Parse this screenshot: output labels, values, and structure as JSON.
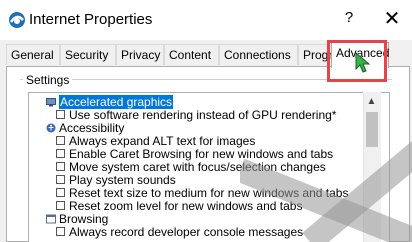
{
  "window": {
    "title": "Internet Properties",
    "help_label": "?",
    "close_label": "✕"
  },
  "tabs": [
    {
      "label": "General",
      "active": false
    },
    {
      "label": "Security",
      "active": false
    },
    {
      "label": "Privacy",
      "active": false
    },
    {
      "label": "Content",
      "active": false
    },
    {
      "label": "Connections",
      "active": false
    },
    {
      "label": "Programs",
      "active": false
    },
    {
      "label": "Advanced",
      "active": true
    }
  ],
  "settings": {
    "group_label": "Settings",
    "items": [
      {
        "type": "group",
        "icon": "monitor-icon",
        "label": "Accelerated graphics",
        "selected": true
      },
      {
        "type": "checkbox",
        "label": "Use software rendering instead of GPU rendering*",
        "checked": false
      },
      {
        "type": "group",
        "icon": "accessibility-icon",
        "label": "Accessibility"
      },
      {
        "type": "checkbox",
        "label": "Always expand ALT text for images",
        "checked": false
      },
      {
        "type": "checkbox",
        "label": "Enable Caret Browsing for new windows and tabs",
        "checked": false
      },
      {
        "type": "checkbox",
        "label": "Move system caret with focus/selection changes",
        "checked": false
      },
      {
        "type": "checkbox",
        "label": "Play system sounds",
        "checked": false
      },
      {
        "type": "checkbox",
        "label": "Reset text size to medium for new windows and tabs",
        "checked": false
      },
      {
        "type": "checkbox",
        "label": "Reset zoom level for new windows and tabs",
        "checked": false
      },
      {
        "type": "group",
        "icon": "browsing-icon",
        "label": "Browsing"
      },
      {
        "type": "checkbox",
        "label": "Always record developer console messages",
        "checked": false
      }
    ]
  },
  "colors": {
    "selection": "#0078d7",
    "highlight_box": "#e8434b",
    "cursor": "#35b34a"
  }
}
